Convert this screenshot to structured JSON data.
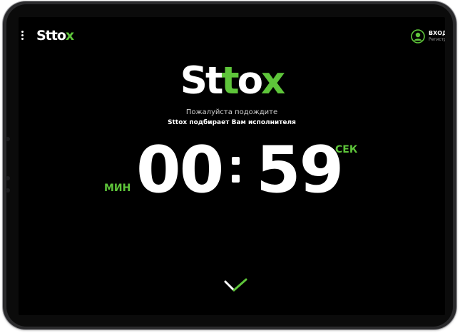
{
  "header": {
    "brand": "Sttox",
    "login_label": "ВХОД",
    "register_label": "Регистр"
  },
  "hero": {
    "logo": "Sttox",
    "line1": "Пожалуйста подождите",
    "line2": "Sttox подбирает Вам исполнителя"
  },
  "timer": {
    "minutes": "00",
    "seconds": "59",
    "minutes_label": "МИН",
    "seconds_label": "СЕК"
  },
  "colors": {
    "accent": "#5ec53a",
    "background": "#000000",
    "text": "#ffffff"
  },
  "icons": {
    "menu": "vertical-dots-icon",
    "user": "user-circle-icon",
    "down": "chevron-down-icon"
  }
}
